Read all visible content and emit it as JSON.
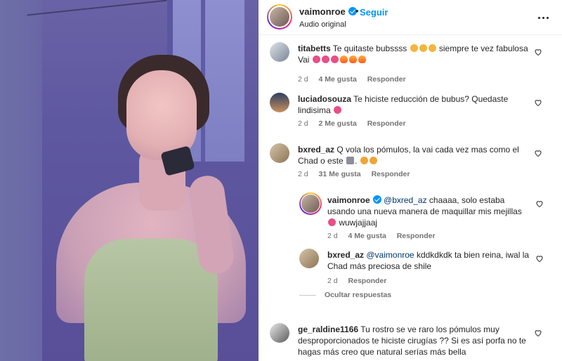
{
  "header": {
    "username": "vaimonroe",
    "dot": "•",
    "follow_label": "Seguir",
    "audio_label": "Audio original"
  },
  "comments": [
    {
      "username": "titabetts",
      "text_a": "Te quitaste bubssss",
      "text_b": "siempre te vez fabulosa Vai",
      "time": "2 d",
      "likes": "4 Me gusta",
      "reply": "Responder"
    },
    {
      "username": "luciadosouza",
      "text": "Te hiciste reducción de bubus? Quedaste lindisima",
      "time": "2 d",
      "likes": "2 Me gusta",
      "reply": "Responder"
    },
    {
      "username": "bxred_az",
      "text": "Q vola los pómulos, la vai cada vez mas como el Chad o este",
      "time": "2 d",
      "likes": "31 Me gusta",
      "reply": "Responder"
    }
  ],
  "replies": [
    {
      "username": "vaimonroe",
      "mention": "@bxred_az",
      "text": "chaaaa, solo estaba usando una nueva manera de maquillar mis mejillas",
      "text_end": "wuwjajjaaj",
      "time": "2 d",
      "likes": "4 Me gusta",
      "reply": "Responder"
    },
    {
      "username": "bxred_az",
      "mention": "@vaimonroe",
      "text": "kddkdkdk ta bien reina, iwal la Chad más preciosa de shile",
      "time": "2 d",
      "reply": "Responder"
    }
  ],
  "hide_replies_label": "Ocultar respuestas",
  "last_comment": {
    "username": "ge_raldine1166",
    "text": "Tu rostro se ve raro los pómulos muy desproporcionados te hiciste cirugías ?? Si es así porfa no te hagas más creo que natural serías más bella"
  },
  "colors": {
    "accent": "#0095f6",
    "text": "#262626",
    "muted": "#737373",
    "mention": "#00376b"
  }
}
